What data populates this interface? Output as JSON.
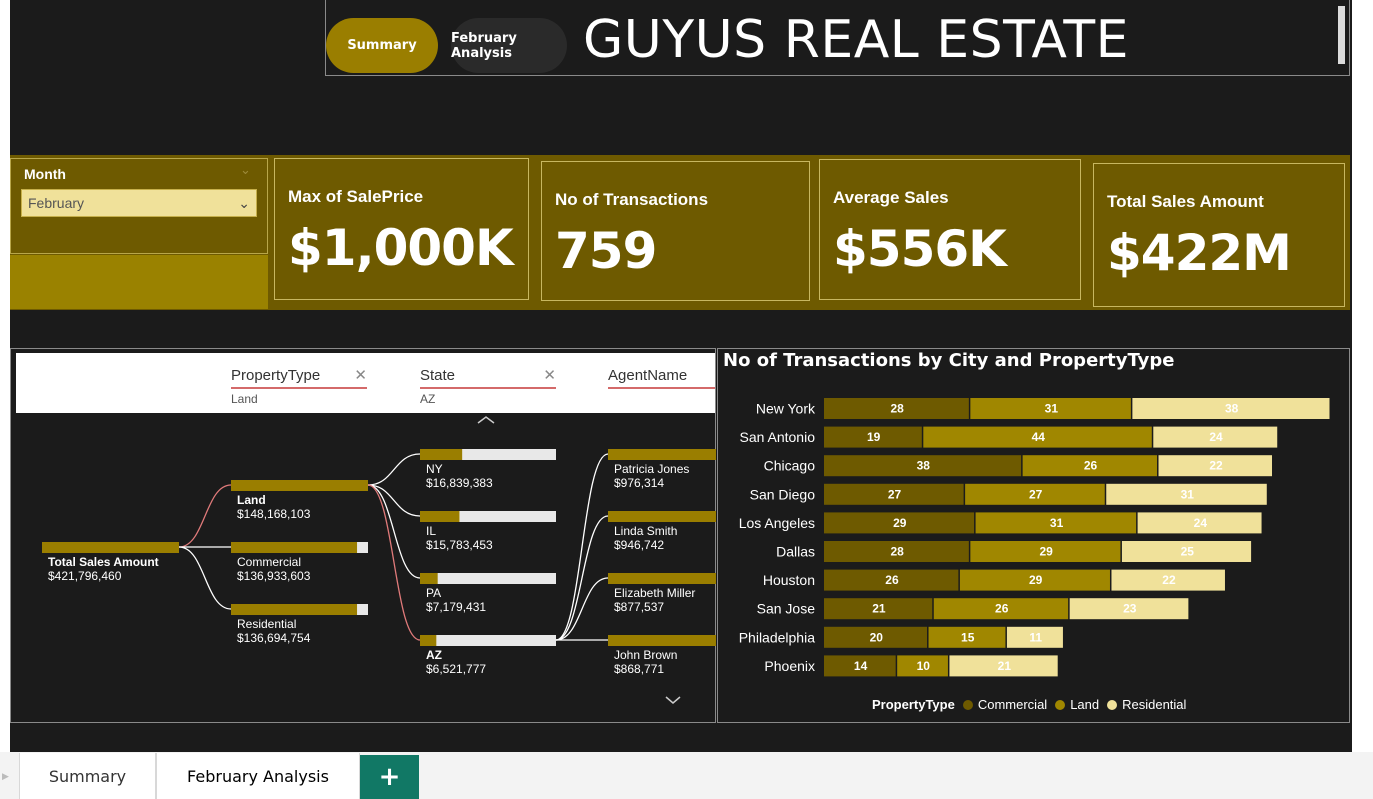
{
  "app": {
    "title": "GUYUS REAL ESTATE",
    "nav_buttons": [
      "Summary",
      "February Analysis"
    ]
  },
  "slicer": {
    "title": "Month",
    "value": "February"
  },
  "kpis": [
    {
      "label": "Max of SalePrice",
      "value": "$1,000K"
    },
    {
      "label": "No of Transactions",
      "value": "759"
    },
    {
      "label": "Average Sales",
      "value": "$556K"
    },
    {
      "label": "Total Sales Amount",
      "value": "$422M"
    }
  ],
  "decomposition_tree": {
    "fields": [
      {
        "name": "PropertyType",
        "value": "Land"
      },
      {
        "name": "State",
        "value": "AZ"
      },
      {
        "name": "AgentName",
        "value": ""
      }
    ],
    "root": {
      "label": "Total Sales Amount",
      "value": "$421,796,460"
    },
    "level1": [
      {
        "label": "Land",
        "value": "$148,168,103",
        "share": 1.0
      },
      {
        "label": "Commercial",
        "value": "$136,933,603",
        "share": 0.92
      },
      {
        "label": "Residential",
        "value": "$136,694,754",
        "share": 0.92
      }
    ],
    "level2": [
      {
        "label": "NY",
        "value": "$16,839,383",
        "share": 0.31
      },
      {
        "label": "IL",
        "value": "$15,783,453",
        "share": 0.29
      },
      {
        "label": "PA",
        "value": "$7,179,431",
        "share": 0.13
      },
      {
        "label": "AZ",
        "value": "$6,521,777",
        "share": 0.12
      }
    ],
    "level3": [
      {
        "label": "Patricia Jones",
        "value": "$976,314"
      },
      {
        "label": "Linda Smith",
        "value": "$946,742"
      },
      {
        "label": "Elizabeth Miller",
        "value": "$877,537"
      },
      {
        "label": "John Brown",
        "value": "$868,771"
      }
    ]
  },
  "chart_data": {
    "type": "bar",
    "orientation": "horizontal",
    "stacked": true,
    "title": "No of Transactions by City and PropertyType",
    "categories": [
      "New York",
      "San Antonio",
      "Chicago",
      "San Diego",
      "Los Angeles",
      "Dallas",
      "Houston",
      "San Jose",
      "Philadelphia",
      "Phoenix"
    ],
    "series": [
      {
        "name": "Commercial",
        "color": "#6e5a00",
        "values": [
          28,
          19,
          38,
          27,
          29,
          28,
          26,
          21,
          20,
          14
        ]
      },
      {
        "name": "Land",
        "color": "#a08700",
        "values": [
          31,
          44,
          26,
          27,
          31,
          29,
          29,
          26,
          15,
          10
        ]
      },
      {
        "name": "Residential",
        "color": "#f0e19a",
        "values": [
          38,
          24,
          22,
          31,
          24,
          25,
          22,
          23,
          11,
          21
        ]
      }
    ],
    "legend_title": "PropertyType",
    "legend_position": "bottom",
    "grid": false
  },
  "tabs": [
    "Summary",
    "February Analysis"
  ],
  "add_tab": "+"
}
